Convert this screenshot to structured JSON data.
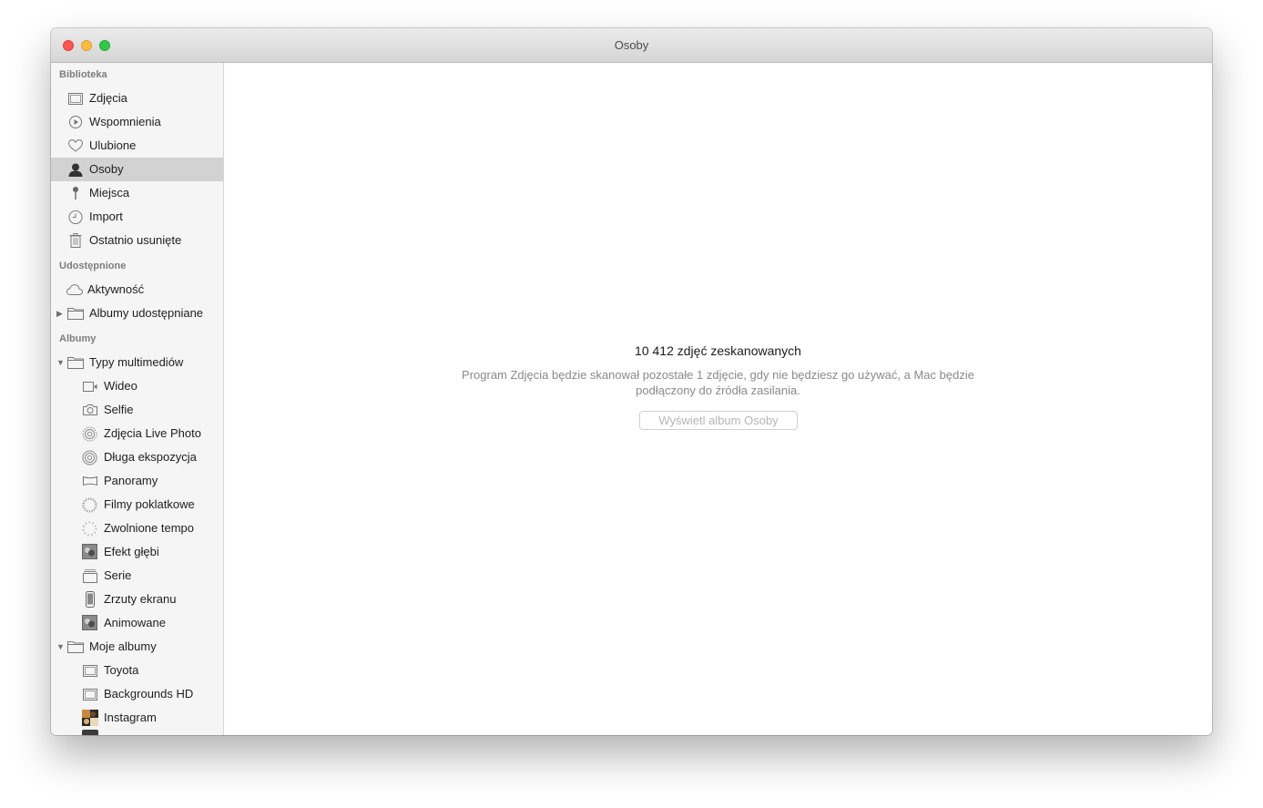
{
  "window": {
    "title": "Osoby"
  },
  "sidebar": {
    "library": {
      "title": "Biblioteka",
      "items": [
        {
          "label": "Zdjęcia",
          "icon": "photos-icon"
        },
        {
          "label": "Wspomnienia",
          "icon": "memories-icon"
        },
        {
          "label": "Ulubione",
          "icon": "heart-icon"
        },
        {
          "label": "Osoby",
          "icon": "person-icon",
          "selected": true
        },
        {
          "label": "Miejsca",
          "icon": "pin-icon"
        },
        {
          "label": "Import",
          "icon": "clock-icon"
        },
        {
          "label": "Ostatnio usunięte",
          "icon": "trash-icon"
        }
      ]
    },
    "shared": {
      "title": "Udostępnione",
      "items": [
        {
          "label": "Aktywność",
          "icon": "cloud-icon"
        },
        {
          "label": "Albumy udostępniane",
          "icon": "folder-icon"
        }
      ]
    },
    "albums": {
      "title": "Albumy",
      "media_types": {
        "label": "Typy multimediów",
        "items": [
          {
            "label": "Wideo",
            "icon": "video-icon"
          },
          {
            "label": "Selfie",
            "icon": "camera-icon"
          },
          {
            "label": "Zdjęcia Live Photo",
            "icon": "live-photo-icon"
          },
          {
            "label": "Długa ekspozycja",
            "icon": "long-exposure-icon"
          },
          {
            "label": "Panoramy",
            "icon": "panorama-icon"
          },
          {
            "label": "Filmy poklatkowe",
            "icon": "timelapse-icon"
          },
          {
            "label": "Zwolnione tempo",
            "icon": "slowmo-icon"
          },
          {
            "label": "Efekt głębi",
            "icon": "depth-icon"
          },
          {
            "label": "Serie",
            "icon": "burst-icon"
          },
          {
            "label": "Zrzuty ekranu",
            "icon": "screenshot-icon"
          },
          {
            "label": "Animowane",
            "icon": "animated-icon"
          }
        ]
      },
      "my_albums": {
        "label": "Moje albumy",
        "items": [
          {
            "label": "Toyota",
            "icon": "album-icon"
          },
          {
            "label": "Backgrounds HD",
            "icon": "album-icon"
          },
          {
            "label": "Instagram",
            "icon": "instagram-thumb-icon"
          }
        ]
      }
    }
  },
  "main": {
    "heading": "10 412 zdjęć zeskanowanych",
    "message": "Program Zdjęcia będzie skanował pozostałe 1 zdjęcie, gdy nie będziesz go używać, a Mac będzie podłączony do źródła zasilania.",
    "button": "Wyświetl album Osoby"
  }
}
